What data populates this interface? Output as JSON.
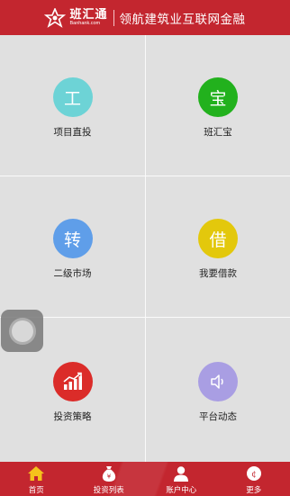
{
  "header": {
    "logo_cn": "班汇通",
    "logo_en": "Banhank.com",
    "slogan": "领航建筑业互联网金融"
  },
  "grid": {
    "items": [
      {
        "icon_char": "工",
        "label": "项目直投",
        "color": "#6dd3d6"
      },
      {
        "icon_char": "宝",
        "label": "班汇宝",
        "color": "#22b11d"
      },
      {
        "icon_char": "转",
        "label": "二级市场",
        "color": "#5f9ee9"
      },
      {
        "icon_char": "借",
        "label": "我要借款",
        "color": "#e3c80c"
      },
      {
        "icon_char": "",
        "label": "投资策略",
        "color": "#db2c29"
      },
      {
        "icon_char": "",
        "label": "平台动态",
        "color": "#a99ee3"
      }
    ]
  },
  "tabbar": {
    "items": [
      {
        "label": "首页"
      },
      {
        "label": "投资列表"
      },
      {
        "label": "账户中心"
      },
      {
        "label": "更多"
      }
    ]
  },
  "colors": {
    "brand_red": "#c3262f",
    "tab_active_icon": "#f5c21b"
  }
}
